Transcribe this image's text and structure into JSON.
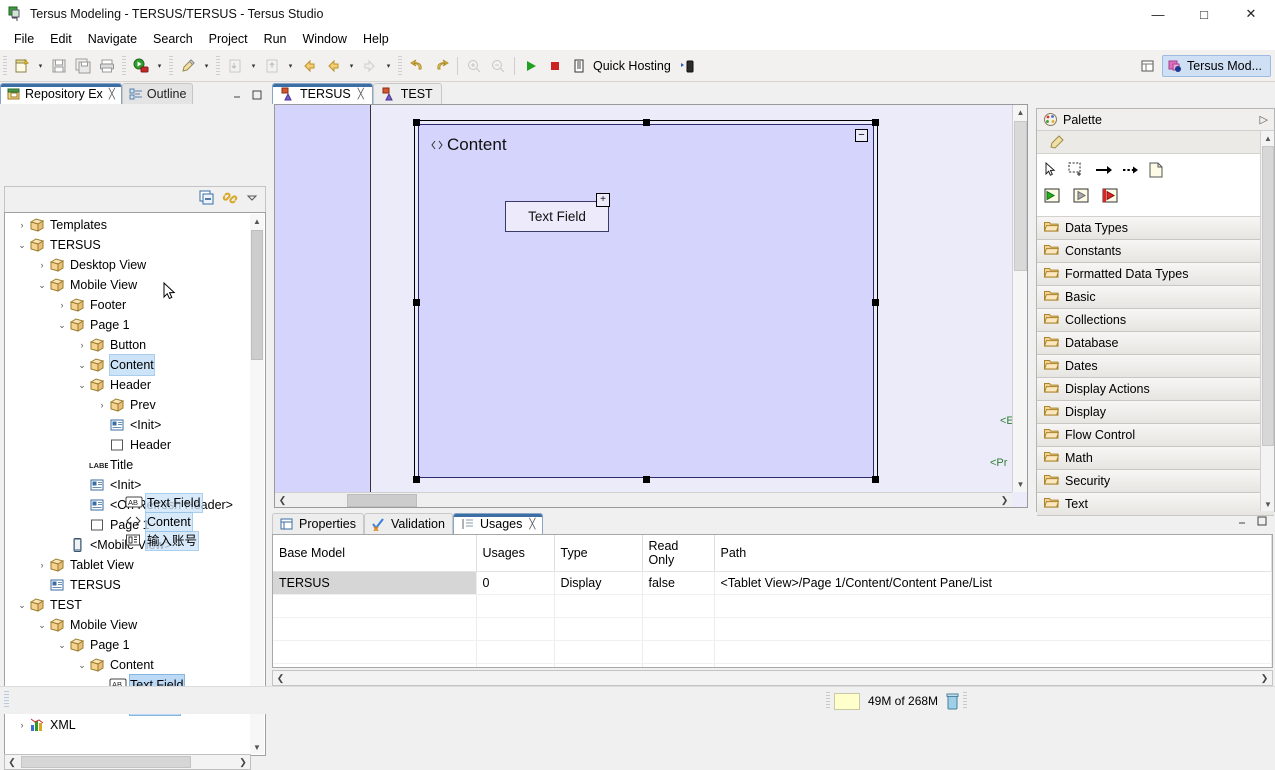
{
  "window": {
    "title": "Tersus Modeling - TERSUS/TERSUS - Tersus Studio",
    "minimize": "—",
    "maximize": "□",
    "close": "✕"
  },
  "menubar": {
    "items": [
      "File",
      "Edit",
      "Navigate",
      "Search",
      "Project",
      "Run",
      "Window",
      "Help"
    ]
  },
  "toolbar": {
    "quick_hosting_label": "Quick Hosting",
    "perspective_current": "Tersus Mod..."
  },
  "left_view": {
    "tabs": [
      {
        "label": "Repository Ex",
        "icon": "repository-icon",
        "active": true,
        "closable": true
      },
      {
        "label": "Outline",
        "icon": "outline-icon",
        "active": false,
        "closable": false
      }
    ],
    "view_buttons": [
      "collapse-all-icon",
      "link-with-editor-icon",
      "view-menu-icon"
    ],
    "tree": [
      {
        "indent": 1,
        "twist": "›",
        "icon": "package",
        "label": "Templates",
        "state": ""
      },
      {
        "indent": 1,
        "twist": "⌄",
        "icon": "package",
        "label": "TERSUS",
        "state": ""
      },
      {
        "indent": 2,
        "twist": "›",
        "icon": "package",
        "label": "Desktop View",
        "state": ""
      },
      {
        "indent": 2,
        "twist": "⌄",
        "icon": "package",
        "label": "Mobile View",
        "state": ""
      },
      {
        "indent": 3,
        "twist": "›",
        "icon": "package",
        "label": "Footer",
        "state": ""
      },
      {
        "indent": 3,
        "twist": "⌄",
        "icon": "package",
        "label": "Page 1",
        "state": ""
      },
      {
        "indent": 4,
        "twist": "›",
        "icon": "package",
        "label": "Button",
        "state": ""
      },
      {
        "indent": 4,
        "twist": "⌄",
        "icon": "package",
        "label": "Content",
        "state": "sel"
      },
      {
        "indent": 4,
        "twist": "⌄",
        "icon": "package",
        "label": "Header",
        "state": ""
      },
      {
        "indent": 5,
        "twist": "›",
        "icon": "package",
        "label": "Prev",
        "state": ""
      },
      {
        "indent": 5,
        "twist": "",
        "icon": "action",
        "label": "<Init>",
        "state": ""
      },
      {
        "indent": 5,
        "twist": "",
        "icon": "pane",
        "label": "Header",
        "state": ""
      },
      {
        "indent": 4,
        "twist": "",
        "icon": "label",
        "label": "Title",
        "state": ""
      },
      {
        "indent": 4,
        "twist": "",
        "icon": "action",
        "label": "<Init>",
        "state": ""
      },
      {
        "indent": 4,
        "twist": "",
        "icon": "action",
        "label": "<On Refresh Header>",
        "state": ""
      },
      {
        "indent": 4,
        "twist": "",
        "icon": "pane",
        "label": "Page 1",
        "state": ""
      },
      {
        "indent": 3,
        "twist": "",
        "icon": "mobile",
        "label": "<Mobile View>",
        "state": ""
      },
      {
        "indent": 2,
        "twist": "›",
        "icon": "package",
        "label": "Tablet View",
        "state": ""
      },
      {
        "indent": 2,
        "twist": "",
        "icon": "action",
        "label": "TERSUS",
        "state": ""
      },
      {
        "indent": 1,
        "twist": "⌄",
        "icon": "package",
        "label": "TEST",
        "state": ""
      },
      {
        "indent": 2,
        "twist": "⌄",
        "icon": "package",
        "label": "Mobile View",
        "state": ""
      },
      {
        "indent": 3,
        "twist": "⌄",
        "icon": "package",
        "label": "Page 1",
        "state": ""
      },
      {
        "indent": 4,
        "twist": "⌄",
        "icon": "package",
        "label": "Content",
        "state": ""
      },
      {
        "indent": 5,
        "twist": "",
        "icon": "textfield",
        "label": "Text Field",
        "state": "selstrong"
      },
      {
        "indent": 5,
        "twist": "",
        "icon": "cjk",
        "label": "输入账号",
        "state": "selstrong"
      },
      {
        "indent": 1,
        "twist": "›",
        "icon": "xml",
        "label": "XML",
        "state": ""
      }
    ],
    "drag_ghost": [
      {
        "icon": "textfield",
        "label": "Text Field"
      },
      {
        "icon": "element",
        "label": "Content"
      },
      {
        "icon": "cjk",
        "label": "输入账号"
      }
    ]
  },
  "editor": {
    "tabs": [
      {
        "label": "TERSUS",
        "active": true,
        "closable": true
      },
      {
        "label": "TEST",
        "active": false,
        "closable": false
      }
    ],
    "canvas": {
      "content_title": "Content",
      "collapse_glyph": "−",
      "text_field_label": "Text Field",
      "text_field_plus": "+",
      "edge_labels": [
        "<El",
        "<Pr"
      ],
      "colors": {
        "canvas_bg": "#ebebfa",
        "band_fill": "#d4d4fc",
        "content_fill": "#d4d4fc",
        "content_border": "#2b2b6b",
        "field_fill": "#eceafb",
        "edge_label": "#2e7d32"
      }
    }
  },
  "bottom_view": {
    "tabs": [
      {
        "label": "Properties",
        "icon": "properties-icon",
        "active": false,
        "closable": false
      },
      {
        "label": "Validation",
        "icon": "validation-icon",
        "active": false,
        "closable": false
      },
      {
        "label": "Usages",
        "icon": "usages-icon",
        "active": true,
        "closable": true
      }
    ],
    "table": {
      "columns": [
        "Base Model",
        "Usages",
        "Type",
        "Read Only",
        "Path"
      ],
      "rows": [
        {
          "base_model": "TERSUS",
          "usages": "0",
          "type": "Display",
          "read_only": "false",
          "path": "<Tablet View>/Page 1/Content/Content Pane/List",
          "selected": true
        }
      ],
      "empty_rows": 4
    }
  },
  "palette": {
    "title": "Palette",
    "tools": [
      {
        "name": "select-tool",
        "glyph": "pointer"
      },
      {
        "name": "marquee-tool",
        "glyph": "marquee"
      },
      {
        "name": "connection-tool",
        "glyph": "arrow"
      },
      {
        "name": "dashed-connection-tool",
        "glyph": "dashed-arrow"
      },
      {
        "name": "note-tool",
        "glyph": "note"
      },
      {
        "name": "start-trigger-tool",
        "glyph": "green-start"
      },
      {
        "name": "middle-trigger-tool",
        "glyph": "gray-mid"
      },
      {
        "name": "end-trigger-tool",
        "glyph": "red-end"
      }
    ],
    "drawers": [
      "Data Types",
      "Constants",
      "Formatted Data Types",
      "Basic",
      "Collections",
      "Database",
      "Dates",
      "Display Actions",
      "Display",
      "Flow Control",
      "Math",
      "Security",
      "Text"
    ]
  },
  "statusbar": {
    "heap_text": "49M of 268M"
  }
}
